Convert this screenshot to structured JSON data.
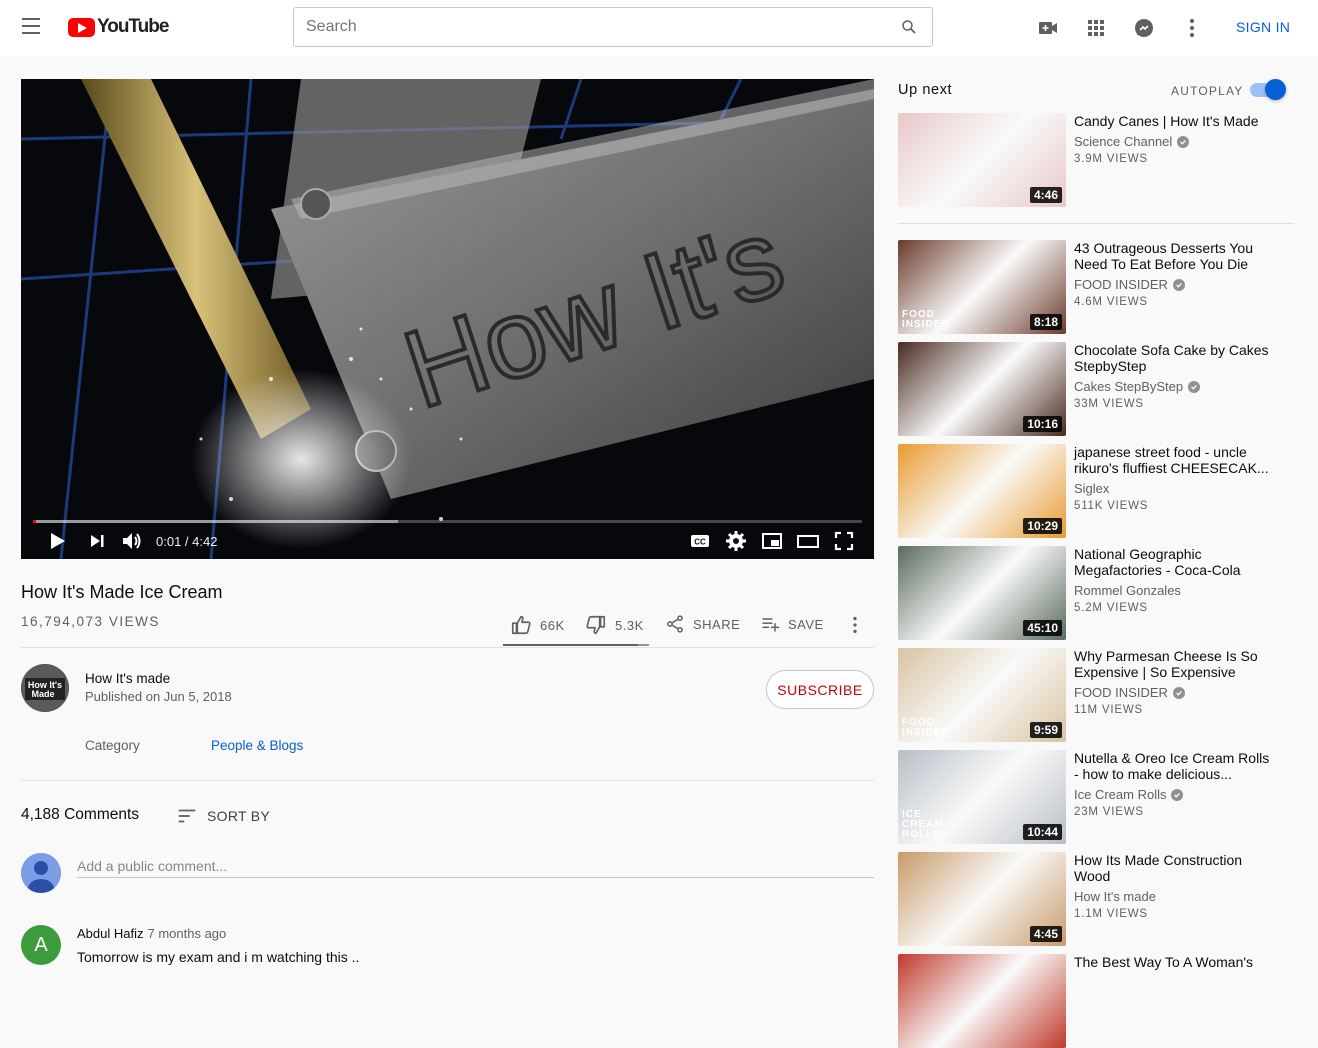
{
  "header": {
    "logo_text": "YouTube",
    "search_placeholder": "Search",
    "sign_in": "SIGN IN",
    "icons": [
      "menu-icon",
      "create-video-icon",
      "apps-grid-icon",
      "messages-icon",
      "more-vert-icon",
      "search-icon"
    ]
  },
  "player": {
    "current_time": "0:01",
    "separator": "/",
    "duration": "4:42",
    "time_display": "0:01 / 4:42",
    "played_fraction": 0.004,
    "buffered_fraction": 0.44,
    "overlay_text": "How It's",
    "controls": [
      "play-icon",
      "next-icon",
      "volume-icon",
      "captions-icon",
      "settings-icon",
      "miniplayer-icon",
      "theater-icon",
      "fullscreen-icon"
    ]
  },
  "video": {
    "title": "How It's Made Ice Cream",
    "views": "16,794,073 VIEWS",
    "likes": "66K",
    "dislikes": "5.3K",
    "share": "SHARE",
    "save": "SAVE",
    "like_fraction": 0.926
  },
  "channel": {
    "avatar_text": "How It's Made",
    "name": "How It's made",
    "published": "Published on Jun 5, 2018",
    "subscribe": "SUBSCRIBE"
  },
  "meta": {
    "category_label": "Category",
    "category_value": "People & Blogs"
  },
  "comments": {
    "count": "4,188 Comments",
    "sort_by": "SORT BY",
    "placeholder": "Add a public comment...",
    "items": [
      {
        "avatar_letter": "A",
        "author": "Abdul Hafiz",
        "time": "7 months ago",
        "text": "Tomorrow is my exam and i m watching this .."
      }
    ]
  },
  "sidebar": {
    "up_next": "Up next",
    "autoplay": "AUTOPLAY",
    "autoplay_on": true,
    "videos": [
      {
        "title_line1": "Candy Canes | How It's Made",
        "title_line2": "",
        "channel": "Science Channel",
        "verified": true,
        "views": "3.9M VIEWS",
        "duration": "4:46",
        "thumb_color": "#e8c8c8",
        "thumb_badge": ""
      },
      {
        "title_line1": "43 Outrageous Desserts You",
        "title_line2": "Need To Eat Before You Die",
        "channel": "FOOD INSIDER",
        "verified": true,
        "views": "4.6M VIEWS",
        "duration": "8:18",
        "thumb_color": "#6b3a2a",
        "thumb_badge": "FOOD INSIDER"
      },
      {
        "title_line1": "Chocolate Sofa Cake by Cakes",
        "title_line2": "StepbyStep",
        "channel": "Cakes StepByStep",
        "verified": true,
        "views": "33M VIEWS",
        "duration": "10:16",
        "thumb_color": "#4a2a20",
        "thumb_badge": ""
      },
      {
        "title_line1": "japanese street food - uncle",
        "title_line2": "rikuro's fluffiest CHEESECAK...",
        "channel": "Siglex",
        "verified": false,
        "views": "511K VIEWS",
        "duration": "10:29",
        "thumb_color": "#e89a30",
        "thumb_badge": ""
      },
      {
        "title_line1": "National Geographic",
        "title_line2": "Megafactories - Coca-Cola",
        "channel": "Rommel Gonzales",
        "verified": false,
        "views": "5.2M VIEWS",
        "duration": "45:10",
        "thumb_color": "#5a6b5e",
        "thumb_badge": ""
      },
      {
        "title_line1": "Why Parmesan Cheese Is So",
        "title_line2": "Expensive | So Expensive",
        "channel": "FOOD INSIDER",
        "verified": true,
        "views": "11M VIEWS",
        "duration": "9:59",
        "thumb_color": "#d9c3a0",
        "thumb_badge": "FOOD INSIDER"
      },
      {
        "title_line1": "Nutella & Oreo Ice Cream Rolls",
        "title_line2": "- how to make delicious...",
        "channel": "Ice Cream Rolls",
        "verified": true,
        "views": "23M VIEWS",
        "duration": "10:44",
        "thumb_color": "#b8bec6",
        "thumb_badge": "ICE CREAM ROLLS"
      },
      {
        "title_line1": "How Its Made Construction",
        "title_line2": "Wood",
        "channel": "How It's made",
        "verified": false,
        "views": "1.1M VIEWS",
        "duration": "4:45",
        "thumb_color": "#c89a68",
        "thumb_badge": ""
      },
      {
        "title_line1": "The Best Way To A Woman's",
        "title_line2": "",
        "channel": "",
        "verified": false,
        "views": "",
        "duration": "",
        "thumb_color": "#c0392b",
        "thumb_badge": ""
      }
    ]
  },
  "colors": {
    "brand_red": "#ff0000",
    "link_blue": "#065fd4",
    "subscribe_red": "#cc0000"
  }
}
